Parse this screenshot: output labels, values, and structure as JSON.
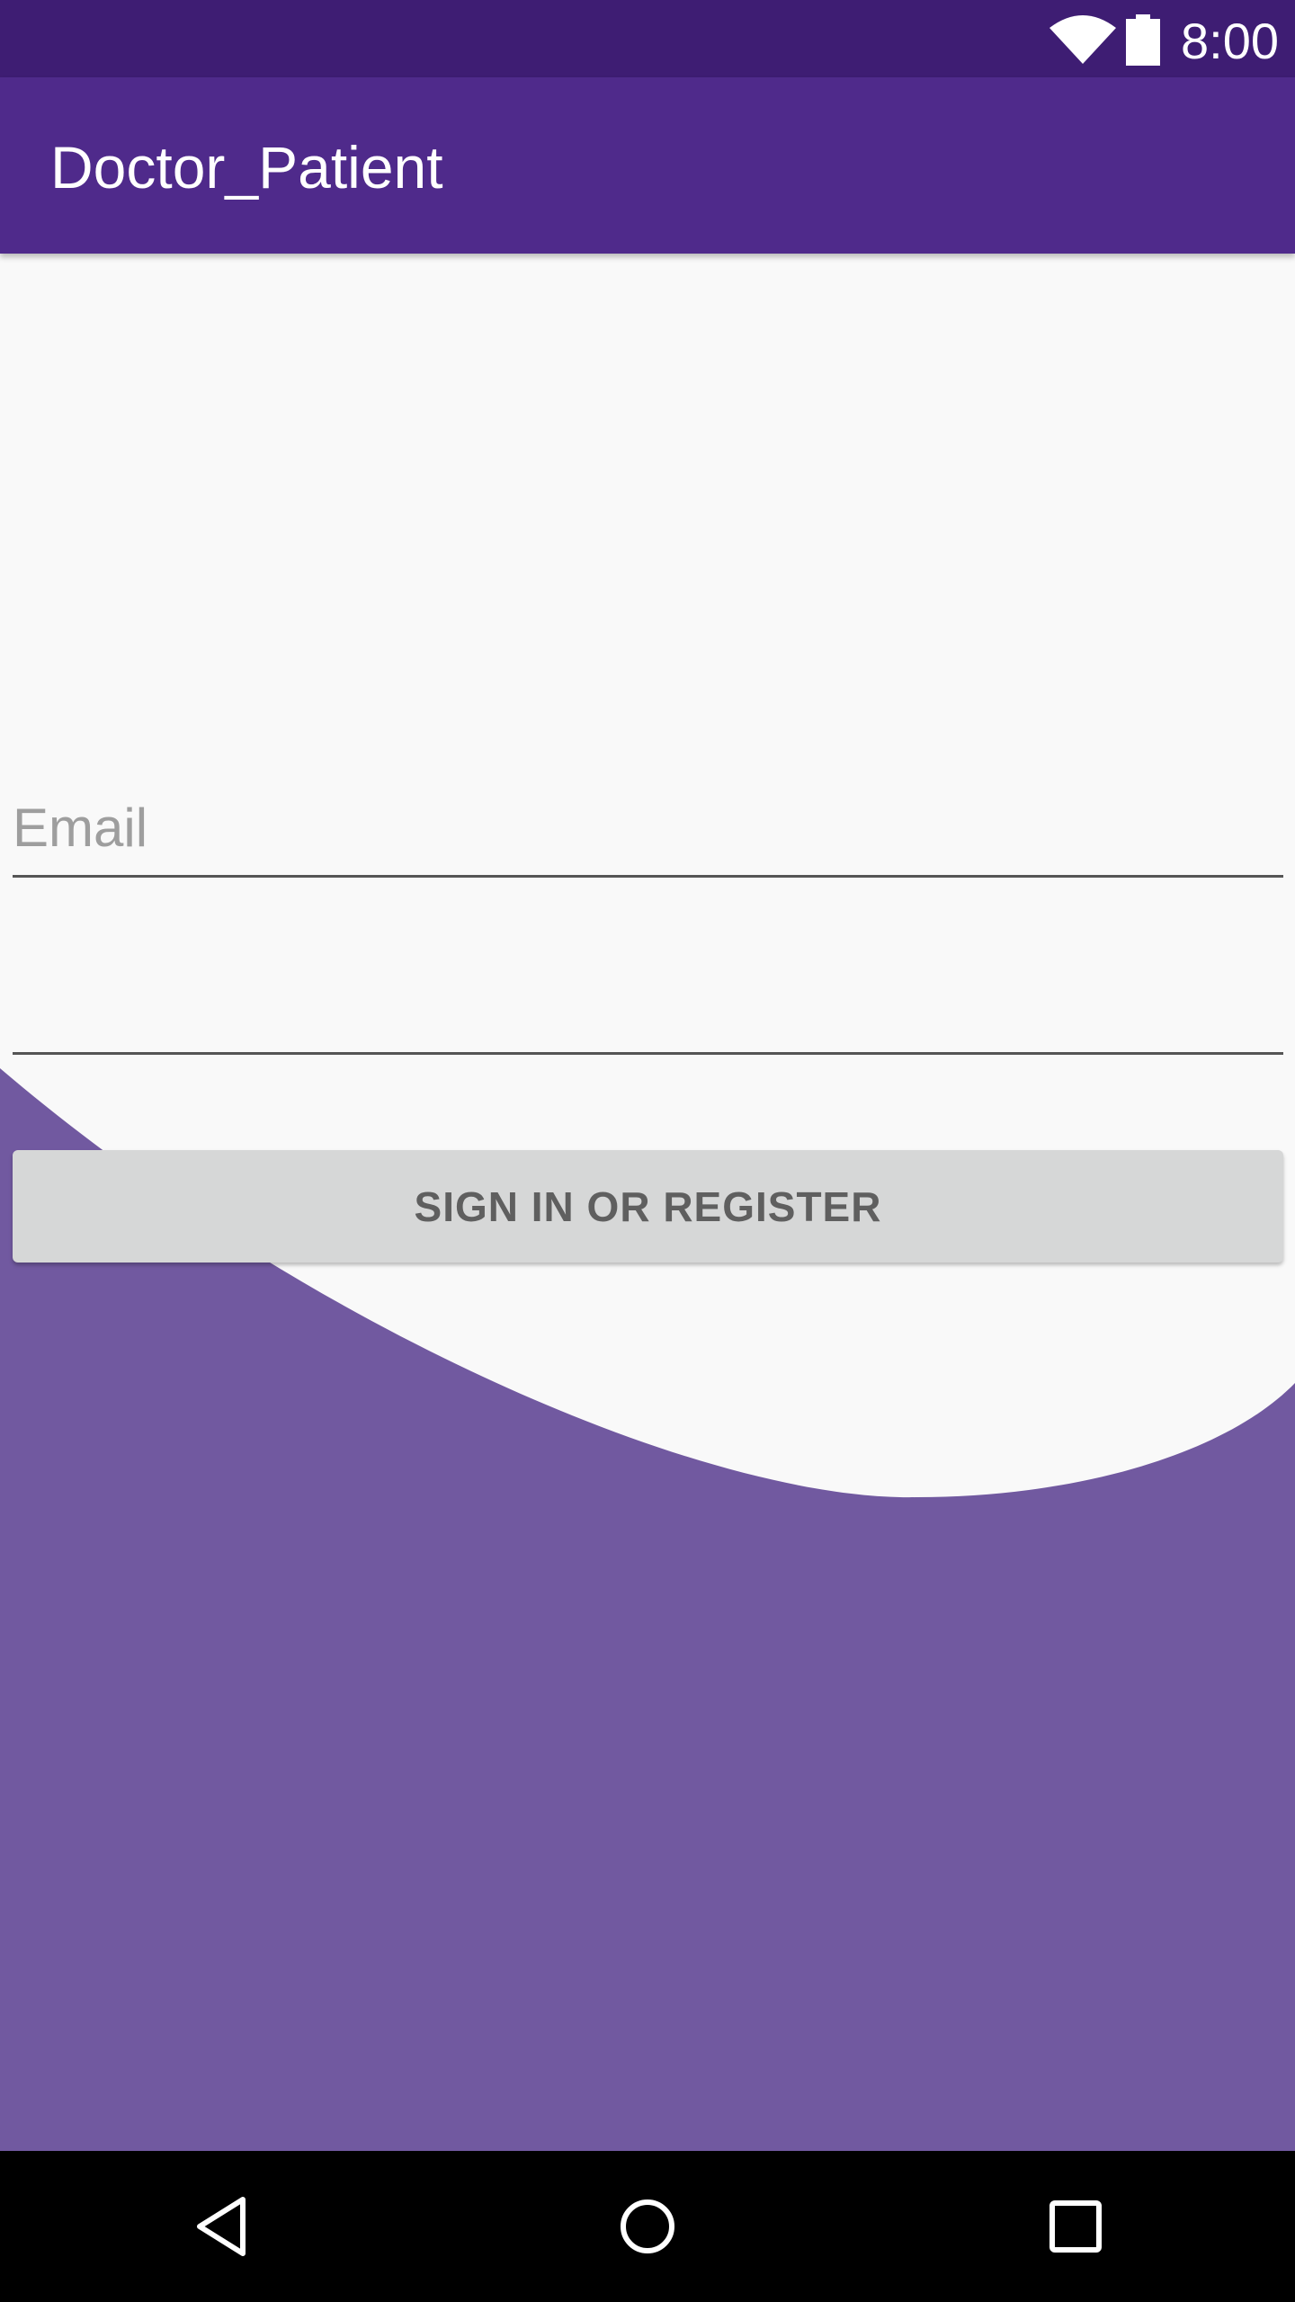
{
  "status_bar": {
    "time": "8:00",
    "icons": [
      "wifi-icon",
      "battery-icon"
    ]
  },
  "app_bar": {
    "title": "Doctor_Patient"
  },
  "form": {
    "email_placeholder": "Email",
    "second_field_value": "",
    "submit_label": "SIGN IN OR REGISTER"
  },
  "nav_bar": {
    "icons": [
      "back-icon",
      "home-icon",
      "recents-icon"
    ]
  },
  "colors": {
    "status_bar": "#3E1D73",
    "app_bar": "#4F2A8B",
    "background": "#F9F9F9",
    "wave": "#7159A0",
    "button": "#D6D7D7"
  }
}
